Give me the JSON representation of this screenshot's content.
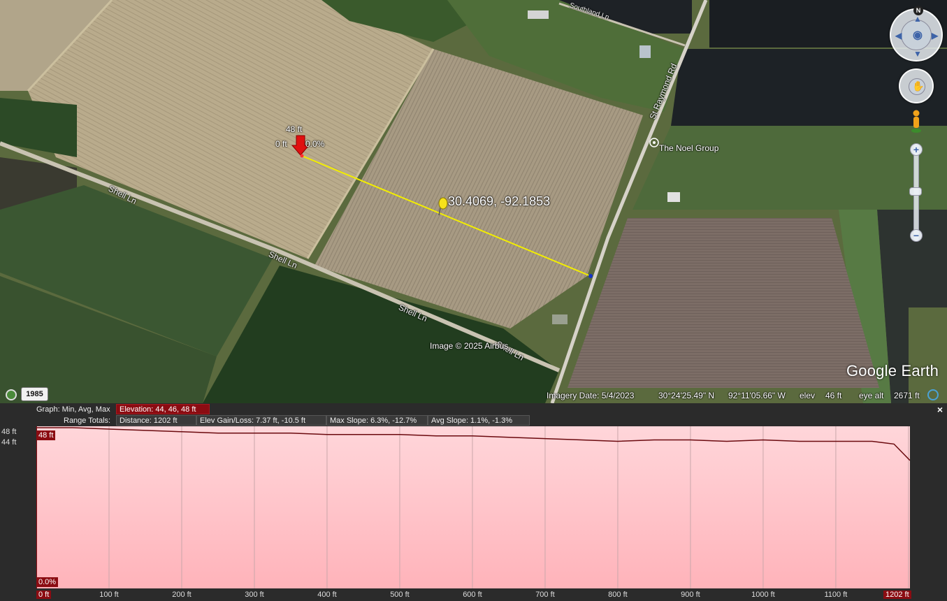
{
  "map": {
    "roads": [
      "Shell Ln",
      "Shell Ln",
      "Shell Ln",
      "St Raymond Rd",
      "Shell Ln"
    ],
    "top_road": "Southland Ln",
    "place": "The Noel Group",
    "coordinate": "30.4069, -92.1853",
    "marker": {
      "elevation": "48 ft",
      "distance": "0 ft",
      "slope": "0.0%"
    },
    "copyright": "Image © 2025 Airbus",
    "logo": "Google Earth",
    "year": "1985",
    "north": "N"
  },
  "status": {
    "imagery_date": "Imagery Date: 5/4/2023",
    "lat": "30°24'25.49\" N",
    "lon": "92°11'05.66\" W",
    "elev_label": "elev",
    "elev_value": "46 ft",
    "eye_alt_label": "eye alt",
    "eye_alt_value": "2671 ft"
  },
  "panel": {
    "graph_label": "Graph: Min, Avg, Max",
    "elevation_stat": "Elevation: 44, 46, 48 ft",
    "range_label": "Range Totals:",
    "distance_stat": "Distance: 1202 ft",
    "gain_stat": "Elev Gain/Loss: 7.37 ft, -10.5 ft",
    "max_slope_stat": "Max Slope: 6.3%, -12.7%",
    "avg_slope_stat": "Avg Slope: 1.1%, -1.3%",
    "y_top": "48 ft",
    "y_bottom": "44 ft",
    "cursor_elev": "48 ft",
    "cursor_slope": "0.0%",
    "close": "×"
  },
  "chart_data": {
    "type": "area",
    "x_unit": "ft",
    "y_unit": "ft",
    "xlim": [
      0,
      1202
    ],
    "ylim": [
      44,
      48
    ],
    "x_ticks": [
      "0 ft",
      "100 ft",
      "200 ft",
      "300 ft",
      "400 ft",
      "500 ft",
      "600 ft",
      "700 ft",
      "800 ft",
      "900 ft",
      "1000 ft",
      "1100 ft",
      "1202 ft"
    ],
    "x": [
      0,
      50,
      100,
      150,
      200,
      250,
      300,
      350,
      400,
      450,
      500,
      550,
      600,
      650,
      700,
      750,
      800,
      850,
      900,
      950,
      1000,
      1050,
      1100,
      1150,
      1180,
      1202
    ],
    "y": [
      48,
      48,
      47.9,
      47.8,
      47.7,
      47.6,
      47.6,
      47.6,
      47.5,
      47.5,
      47.5,
      47.4,
      47.4,
      47.3,
      47.2,
      47.1,
      47.0,
      47.1,
      47.1,
      47.0,
      47.1,
      47.0,
      47.0,
      47.0,
      46.8,
      45.6
    ],
    "colors": {
      "line": "#6b0a0f",
      "fill_top": "#ffd6da",
      "fill_bottom": "#ffb3ba"
    }
  }
}
